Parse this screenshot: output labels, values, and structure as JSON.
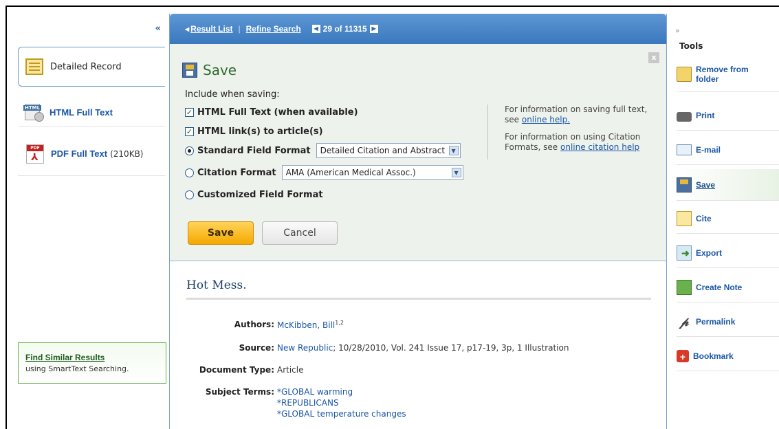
{
  "left": {
    "collapse": "«",
    "items": [
      {
        "label": "Detailed Record"
      },
      {
        "label": "HTML Full Text"
      },
      {
        "label": "PDF Full Text",
        "size": "(210KB)"
      }
    ],
    "similar": {
      "title": "Find Similar Results",
      "subtitle": "using SmartText Searching."
    }
  },
  "topbar": {
    "result_list": "Result List",
    "refine": "Refine Search",
    "position": "29 of 11315"
  },
  "save_panel": {
    "title": "Save",
    "include_label": "Include when saving:",
    "checkbox_html": "HTML Full Text (when available)",
    "checkbox_links": "HTML link(s) to article(s)",
    "radio_standard": "Standard Field Format",
    "standard_select": "Detailed Citation and Abstract",
    "radio_citation": "Citation Format",
    "citation_select": "AMA (American Medical Assoc.)",
    "radio_custom": "Customized Field Format",
    "info1_text": "For information on saving full text, see",
    "info1_link": "online help.",
    "info2_text": "For information on using Citation Formats, see",
    "info2_link": "online citation help",
    "save_button": "Save",
    "cancel_button": "Cancel"
  },
  "record": {
    "title": "Hot Mess.",
    "authors_label": "Authors:",
    "author": "McKibben, Bill",
    "author_sup": "1,2",
    "source_label": "Source:",
    "source_link": "New Republic",
    "source_rest": "; 10/28/2010, Vol. 241 Issue 17, p17-19, 3p, 1 Illustration",
    "doctype_label": "Document Type:",
    "doctype": "Article",
    "subject_label": "Subject Terms:",
    "subjects": [
      "*GLOBAL warming",
      "*REPUBLICANS",
      "*GLOBAL temperature changes"
    ]
  },
  "tools": {
    "expand": "»",
    "header": "Tools",
    "items": [
      {
        "label": "Remove from folder",
        "icon": "folder-icon"
      },
      {
        "label": "Print",
        "icon": "printer-icon"
      },
      {
        "label": "E-mail",
        "icon": "email-icon"
      },
      {
        "label": "Save",
        "icon": "save-icon"
      },
      {
        "label": "Cite",
        "icon": "cite-icon"
      },
      {
        "label": "Export",
        "icon": "export-icon"
      },
      {
        "label": "Create Note",
        "icon": "note-icon"
      },
      {
        "label": "Permalink",
        "icon": "link-icon"
      },
      {
        "label": "Bookmark",
        "icon": "bookmark-icon"
      }
    ]
  }
}
